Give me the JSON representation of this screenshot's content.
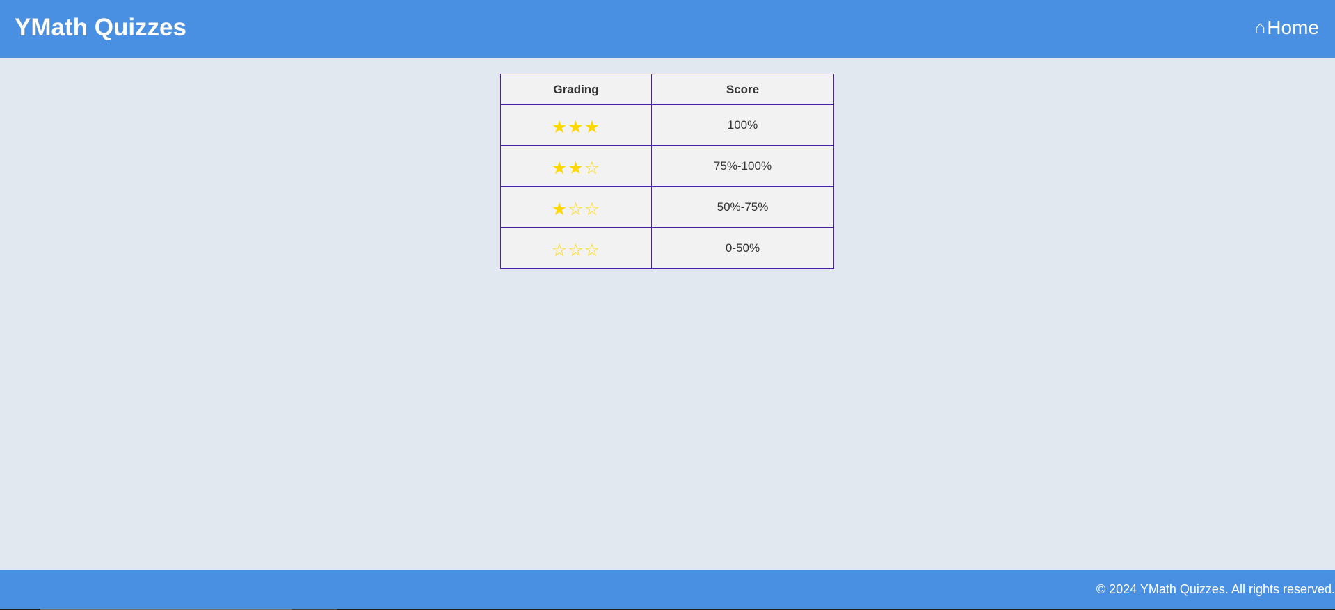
{
  "header": {
    "brand": "YMath Quizzes",
    "home_icon": "⌂",
    "home_label": "Home"
  },
  "colors": {
    "header_bg": "#4a90e2",
    "page_bg": "#e1e8f0",
    "star": "#ffd700",
    "table_border": "#4b1fa8"
  },
  "table": {
    "headers": [
      "Grading",
      "Score"
    ],
    "rows": [
      {
        "stars": "★★★",
        "filled_stars": 3,
        "score": "100%"
      },
      {
        "stars": "★★☆",
        "filled_stars": 2,
        "score": "75%-100%"
      },
      {
        "stars": "★☆☆",
        "filled_stars": 1,
        "score": "50%-75%"
      },
      {
        "stars": "☆☆☆",
        "filled_stars": 0,
        "score": "0-50%"
      }
    ]
  },
  "footer": {
    "text": "© 2024 YMath Quizzes. All rights reserved."
  }
}
